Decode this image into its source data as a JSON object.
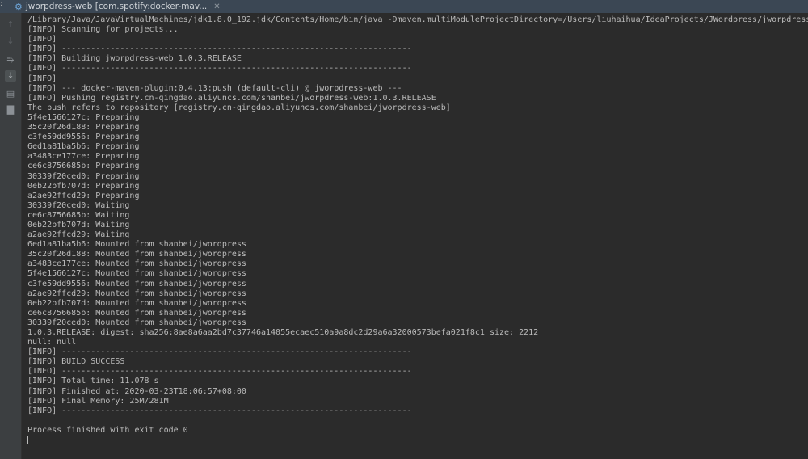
{
  "tab": {
    "title": "jworpdress-web [com.spotify:docker-mav...",
    "icon": "gear-icon"
  },
  "toolbar": [
    "up-arrow-icon",
    "down-arrow-icon",
    "soft-wrap-icon",
    "scroll-to-end-icon",
    "print-icon",
    "trash-icon"
  ],
  "colors": {
    "background": "#2b2b2b",
    "text": "#bbbbbb",
    "gutter": "#3c3f41",
    "tabbar": "#3b4754"
  },
  "console": {
    "lines": [
      "/Library/Java/JavaVirtualMachines/jdk1.8.0_192.jdk/Contents/Home/bin/java -Dmaven.multiModuleProjectDirectory=/Users/liuhaihua/IdeaProjects/JWordpress/jworpdress-web \"",
      "[INFO] Scanning for projects...",
      "[INFO]",
      "[INFO] ------------------------------------------------------------------------",
      "[INFO] Building jworpdress-web 1.0.3.RELEASE",
      "[INFO] ------------------------------------------------------------------------",
      "[INFO]",
      "[INFO] --- docker-maven-plugin:0.4.13:push (default-cli) @ jworpdress-web ---",
      "[INFO] Pushing registry.cn-qingdao.aliyuncs.com/shanbei/jworpdress-web:1.0.3.RELEASE",
      "The push refers to repository [registry.cn-qingdao.aliyuncs.com/shanbei/jworpdress-web]",
      "5f4e1566127c: Preparing",
      "35c20f26d188: Preparing",
      "c3fe59dd9556: Preparing",
      "6ed1a81ba5b6: Preparing",
      "a3483ce177ce: Preparing",
      "ce6c8756685b: Preparing",
      "30339f20ced0: Preparing",
      "0eb22bfb707d: Preparing",
      "a2ae92ffcd29: Preparing",
      "30339f20ced0: Waiting",
      "ce6c8756685b: Waiting",
      "0eb22bfb707d: Waiting",
      "a2ae92ffcd29: Waiting",
      "6ed1a81ba5b6: Mounted from shanbei/jwordpress",
      "35c20f26d188: Mounted from shanbei/jwordpress",
      "a3483ce177ce: Mounted from shanbei/jwordpress",
      "5f4e1566127c: Mounted from shanbei/jwordpress",
      "c3fe59dd9556: Mounted from shanbei/jwordpress",
      "a2ae92ffcd29: Mounted from shanbei/jwordpress",
      "0eb22bfb707d: Mounted from shanbei/jwordpress",
      "ce6c8756685b: Mounted from shanbei/jwordpress",
      "30339f20ced0: Mounted from shanbei/jwordpress",
      "1.0.3.RELEASE: digest: sha256:8ae8a6aa2bd7c37746a14055ecaec510a9a8dc2d29a6a32000573befa021f8c1 size: 2212",
      "null: null",
      "[INFO] ------------------------------------------------------------------------",
      "[INFO] BUILD SUCCESS",
      "[INFO] ------------------------------------------------------------------------",
      "[INFO] Total time: 11.078 s",
      "[INFO] Finished at: 2020-03-23T18:06:57+08:00",
      "[INFO] Final Memory: 25M/281M",
      "[INFO] ------------------------------------------------------------------------",
      "",
      "Process finished with exit code 0"
    ]
  }
}
